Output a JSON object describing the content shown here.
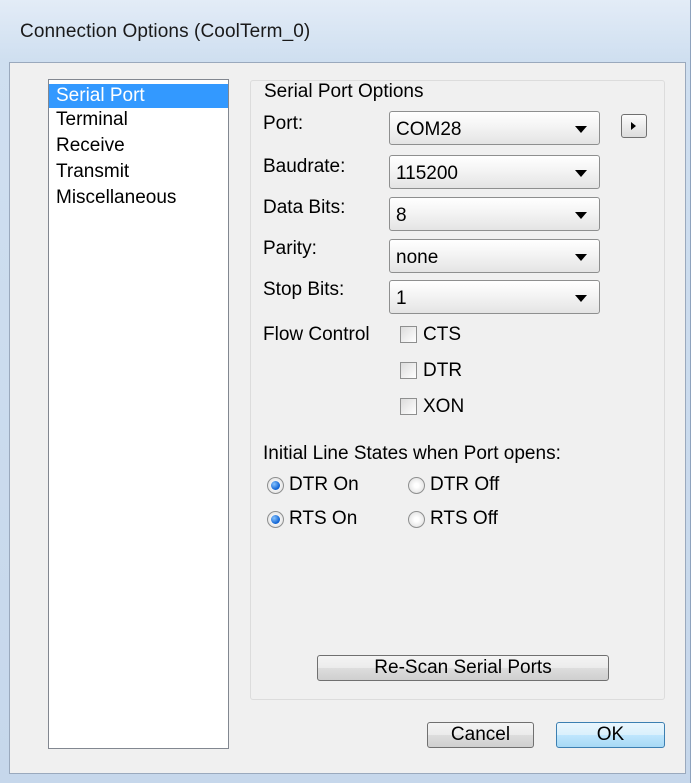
{
  "window": {
    "title": "Connection Options (CoolTerm_0)"
  },
  "categories": [
    {
      "label": "Serial Port",
      "selected": true
    },
    {
      "label": "Terminal",
      "selected": false
    },
    {
      "label": "Receive",
      "selected": false
    },
    {
      "label": "Transmit",
      "selected": false
    },
    {
      "label": "Miscellaneous",
      "selected": false
    }
  ],
  "serial": {
    "group_title": "Serial Port Options",
    "port": {
      "label": "Port:",
      "value": "COM28"
    },
    "baudrate": {
      "label": "Baudrate:",
      "value": "115200"
    },
    "data_bits": {
      "label": "Data Bits:",
      "value": "8"
    },
    "parity": {
      "label": "Parity:",
      "value": "none"
    },
    "stop_bits": {
      "label": "Stop Bits:",
      "value": "1"
    },
    "flow_control": {
      "label": "Flow Control",
      "cts": {
        "label": "CTS",
        "checked": false
      },
      "dtr": {
        "label": "DTR",
        "checked": false
      },
      "xon": {
        "label": "XON",
        "checked": false
      }
    },
    "line_states": {
      "heading": "Initial Line States when Port opens:",
      "dtr_on": {
        "label": "DTR On",
        "selected": true
      },
      "dtr_off": {
        "label": "DTR Off",
        "selected": false
      },
      "rts_on": {
        "label": "RTS On",
        "selected": true
      },
      "rts_off": {
        "label": "RTS Off",
        "selected": false
      }
    },
    "rescan_label": "Re-Scan Serial Ports"
  },
  "footer": {
    "cancel_label": "Cancel",
    "ok_label": "OK"
  },
  "icons": {
    "port_options": "triangle-right-icon",
    "dropdown": "chevron-down-icon"
  }
}
